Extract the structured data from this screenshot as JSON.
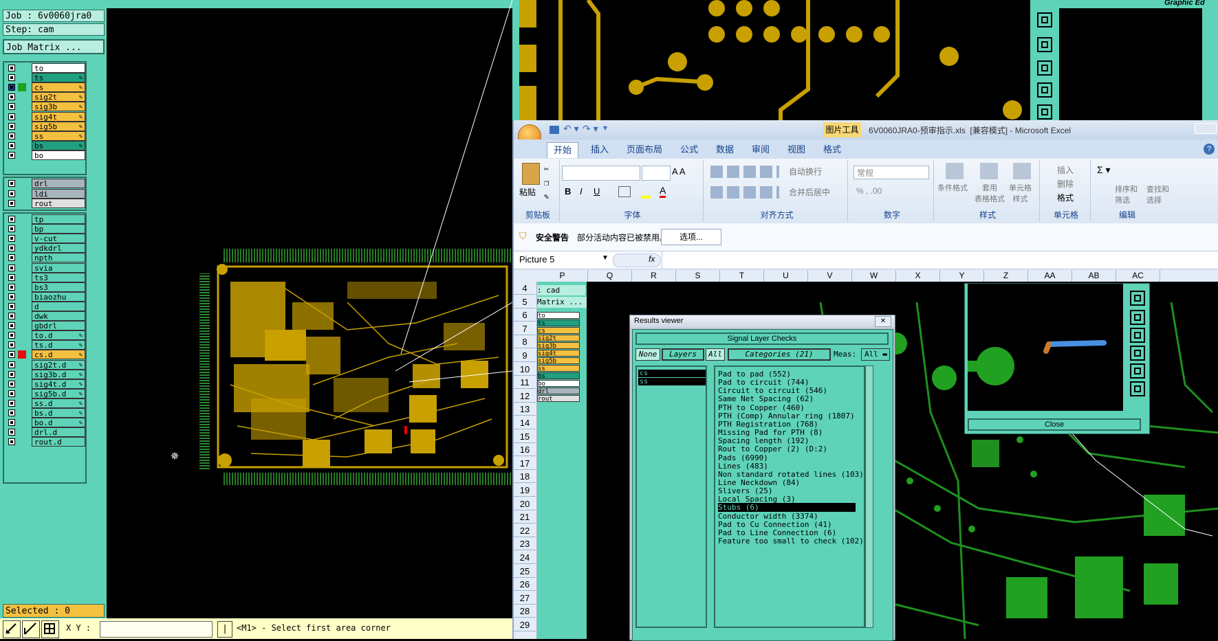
{
  "cam": {
    "job_label": "Job : 6v0060jra0",
    "step_label": "Step: cam",
    "job_matrix_button": "Job Matrix ...",
    "selected_label": "Selected : 0",
    "xy_label": "X Y :",
    "prompt": "<M1> - Select first area corner",
    "graphic_title": "Graphic Ed",
    "layers_group1": [
      {
        "name": "to",
        "color": "#ffffff"
      },
      {
        "name": "ts",
        "color": "#20a080"
      },
      {
        "name": "cs",
        "color": "#f4c040"
      },
      {
        "name": "sig2t",
        "color": "#f4c040"
      },
      {
        "name": "sig3b",
        "color": "#f4c040"
      },
      {
        "name": "sig4t",
        "color": "#f4c040"
      },
      {
        "name": "sig5b",
        "color": "#f4c040"
      },
      {
        "name": "ss",
        "color": "#f4c040"
      },
      {
        "name": "bs",
        "color": "#20a080"
      },
      {
        "name": "bo",
        "color": "#ffffff"
      }
    ],
    "layers_group2": [
      {
        "name": "drl",
        "color": "#a8b4bc"
      },
      {
        "name": "ldi",
        "color": "#a8b4bc"
      },
      {
        "name": "rout",
        "color": "#e0e0e0"
      }
    ],
    "layers_group3": [
      "tp",
      "bp",
      "v-cut",
      "ydkdrl",
      "npth",
      "svia",
      "ts3",
      "bs3",
      "biaozhu",
      "d",
      "dwk",
      "gbdrl",
      "to.d",
      "ts.d",
      "cs.d",
      "sig2t.d",
      "sig3b.d",
      "sig4t.d",
      "sig5b.d",
      "ss.d",
      "bs.d",
      "bo.d",
      "drl.d",
      "rout.d"
    ]
  },
  "excel": {
    "title": "6V0060JRA0-预审指示.xls  [兼容模式] - Microsoft Excel",
    "picture_tools": "图片工具",
    "tabs": [
      "开始",
      "插入",
      "页面布局",
      "公式",
      "数据",
      "审阅",
      "视图",
      "格式"
    ],
    "groups": [
      "剪贴板",
      "字体",
      "对齐方式",
      "数字",
      "样式",
      "单元格",
      "编辑"
    ],
    "paste": "粘贴",
    "wrap_text": "自动换行",
    "merge_center": "合并后居中",
    "number_format": "常规",
    "cond_format": "条件格式",
    "table_format": "套用\n表格格式",
    "cell_style": "单元格\n样式",
    "insert": "插入",
    "delete": "删除",
    "format": "格式",
    "sort_filter": "排序和\n筛选",
    "find": "查找和\n选择",
    "security_title": "安全警告",
    "security_text": "部分活动内容已被禁用。",
    "options_button": "选项...",
    "name_box": "Picture 5",
    "fx": "fx",
    "columns": [
      "P",
      "Q",
      "R",
      "S",
      "T",
      "U",
      "V",
      "W",
      "X",
      "Y",
      "Z",
      "AA",
      "AB",
      "AC"
    ],
    "rows": [
      "4",
      "5",
      "6",
      "7",
      "8",
      "9",
      "10",
      "11",
      "12",
      "13",
      "14",
      "15",
      "16",
      "17",
      "18",
      "19",
      "20",
      "21",
      "22",
      "23",
      "24",
      "25",
      "26",
      "27",
      "28",
      "29"
    ],
    "pasted_step": ": cad",
    "pasted_matrix": "Matrix ..."
  },
  "results": {
    "title": "Results viewer",
    "header": "Signal Layer Checks",
    "none_btn": "None",
    "layers_btn": "Layers",
    "all_btn": "All",
    "categories_btn": "Categories (21)",
    "meas_label": "Meas:",
    "meas_value": "All",
    "layers": [
      "cs",
      "ss"
    ],
    "categories": [
      "Pad to pad (552)",
      "Pad to circuit (744)",
      "Circuit to circuit (546)",
      "Same Net Spacing (62)",
      "PTH to Copper (460)",
      "PTH (Comp) Annular ring (1807)",
      "PTH Registration (768)",
      "Missing Pad for PTH (8)",
      "Spacing length (192)",
      "Rout to Copper (2)         (D:2)",
      "Pads (6990)",
      "Lines (483)",
      "Non standard rotated lines (103)",
      "Line Neckdown (84)",
      "Slivers (25)",
      "Local Spacing (3)",
      "Stubs (6)",
      "Conductor width (3374)",
      "Pad to Cu Connection (41)",
      "Pad to Line Connection (6)",
      "Feature too small to check (102)"
    ],
    "selected_index": 16
  },
  "zoom_window": {
    "close_button": "Close"
  }
}
